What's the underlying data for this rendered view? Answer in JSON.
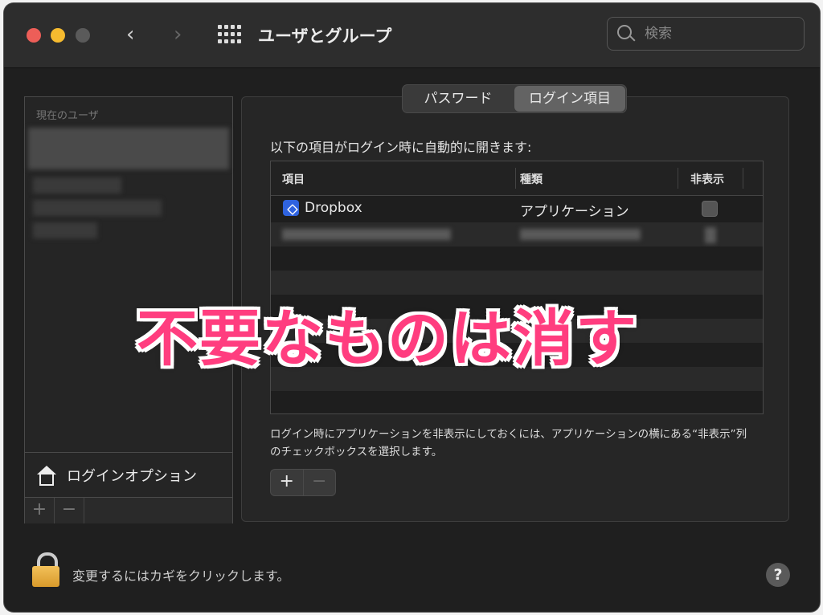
{
  "window": {
    "title": "ユーザとグループ"
  },
  "toolbar": {
    "back_glyph": "‹",
    "forward_glyph": "›",
    "grid_icon": "grid-icon"
  },
  "search": {
    "placeholder": "検索"
  },
  "users": {
    "header": "現在のユーザ",
    "login_options_label": "ログインオプション",
    "add_glyph": "+",
    "remove_glyph": "−"
  },
  "tabs": [
    {
      "label": "パスワード",
      "active": false
    },
    {
      "label": "ログイン項目",
      "active": true
    }
  ],
  "login_items": {
    "intro": "以下の項目がログイン時に自動的に開きます:",
    "columns": {
      "item": "項目",
      "kind": "種類",
      "hide": "非表示"
    },
    "rows": [
      {
        "item": "Dropbox",
        "kind": "アプリケーション",
        "hidden": false
      }
    ],
    "note": "ログイン時にアプリケーションを非表示にしておくには、アプリケーションの横にある“非表示”列のチェックボックスを選択します。",
    "add_glyph": "+",
    "remove_glyph": "−"
  },
  "footer": {
    "lock_text": "変更するにはカギをクリックします。",
    "help_glyph": "?"
  },
  "overlay": {
    "text": "不要なものは消す",
    "color": "#ff3d7f"
  }
}
